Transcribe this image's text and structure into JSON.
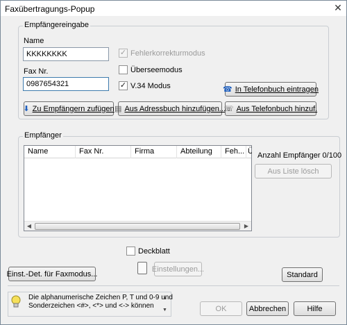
{
  "window": {
    "title": "Faxübertragungs-Popup"
  },
  "recipient_input": {
    "group_label": "Empfängereingabe",
    "name_label": "Name",
    "name_value": "KKKKKKKK",
    "fax_label": "Fax Nr.",
    "fax_value": "0987654321",
    "ecm_label": "Fehlerkorrekturmodus",
    "overseas_label": "Überseemodus",
    "v34_label": "V.34 Modus",
    "phonebook_register_label": "In Telefonbuch eintragen",
    "add_recipient_label": "Zu Empfängern zufügen",
    "add_from_addressbook_label": "Aus Adressbuch hinzufügen...",
    "add_from_phonebook_label": "Aus Telefonbuch hinzuf."
  },
  "recipients": {
    "group_label": "Empfänger",
    "columns": [
      "Name",
      "Fax Nr.",
      "Firma",
      "Abteilung",
      "Feh...",
      "Ü"
    ],
    "count_label": "Anzahl Empfänger 0/100",
    "delete_label": "Aus Liste lösch"
  },
  "cover": {
    "checkbox_label": "Deckblatt",
    "settings_label": "Einstellungen..."
  },
  "buttons": {
    "fax_mode_label": "Einst.-Det. für Faxmodus...",
    "standard_label": "Standard",
    "ok_label": "OK",
    "cancel_label": "Abbrechen",
    "help_label": "Hilfe"
  },
  "hint": {
    "line1": "Die alphanumerische Zeichen P, T und 0-9 und",
    "line2": "Sonderzeichen <#>, <*> und <-> können"
  },
  "colors": {
    "accent_blue": "#1f5fbf",
    "hint_yellow": "#f6e05a"
  },
  "icons": [
    "close-icon",
    "phonebook-add-icon",
    "arrow-down-icon",
    "addressbook-icon",
    "phonebook-icon",
    "lightbulb-icon"
  ]
}
